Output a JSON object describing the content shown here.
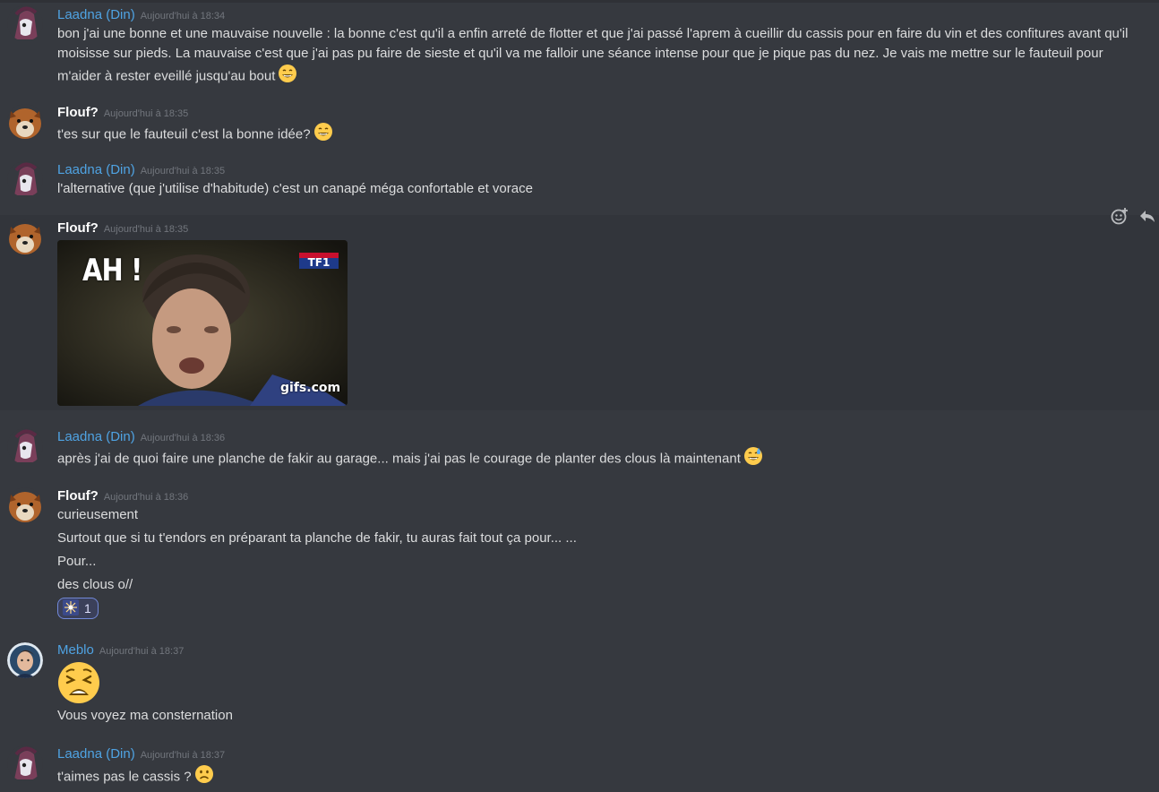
{
  "colors": {
    "background": "#36393f",
    "hover_row": "#32353b",
    "username_blue": "#4fa3e3",
    "username_white": "#ffffff",
    "timestamp": "#72767d",
    "reaction_border": "#7289da"
  },
  "icons": {
    "emoji": "grinning-face-icon",
    "sweat": "grinning-sweat-icon",
    "slight_frown": "slightly-frowning-face-icon",
    "weary": "weary-face-icon",
    "sparkler": "sparkler-icon",
    "add_reaction": "add-reaction-icon",
    "reply": "reply-icon"
  },
  "messages": [
    {
      "author": "Laadna (Din)",
      "timestamp": "Aujourd'hui à 18:34",
      "lines": [
        "bon j'ai une bonne et une mauvaise nouvelle : la bonne c'est qu'il a enfin arreté de flotter et que j'ai passé l'aprem à cueillir du cassis pour en faire du vin et des confitures avant qu'il moisisse sur pieds. La mauvaise c'est que j'ai pas pu faire de sieste et qu'il va me falloir une séance intense pour que je pique pas du nez. Je vais me mettre sur le fauteuil pour m'aider à rester eveillé jusqu'au bout"
      ]
    },
    {
      "author": "Flouf?",
      "timestamp": "Aujourd'hui à 18:35",
      "lines": [
        "t'es sur que le fauteuil c'est la bonne idée?"
      ]
    },
    {
      "author": "Laadna (Din)",
      "timestamp": "Aujourd'hui à 18:35",
      "lines": [
        "l'alternative (que j'utilise d'habitude) c'est un canapé méga confortable et vorace"
      ]
    },
    {
      "author": "Flouf?",
      "timestamp": "Aujourd'hui à 18:35",
      "gif": {
        "caption": "AH !",
        "channel_logo": "TF1",
        "watermark": "gifs.com"
      }
    },
    {
      "author": "Laadna (Din)",
      "timestamp": "Aujourd'hui à 18:36",
      "lines": [
        "après j'ai de quoi faire une planche de fakir au garage... mais j'ai pas le courage de planter des clous là maintenant"
      ]
    },
    {
      "author": "Flouf?",
      "timestamp": "Aujourd'hui à 18:36",
      "lines": [
        "curieusement",
        "Surtout que si tu t'endors en préparant ta planche de fakir, tu auras fait tout ça pour... ...",
        "Pour...",
        "des clous o//"
      ],
      "reaction": {
        "count": "1"
      }
    },
    {
      "author": "Meblo",
      "timestamp": "Aujourd'hui à 18:37",
      "lines": [
        "Vous voyez ma consternation"
      ]
    },
    {
      "author": "Laadna (Din)",
      "timestamp": "Aujourd'hui à 18:37",
      "lines": [
        "t'aimes pas le cassis ?"
      ]
    }
  ]
}
